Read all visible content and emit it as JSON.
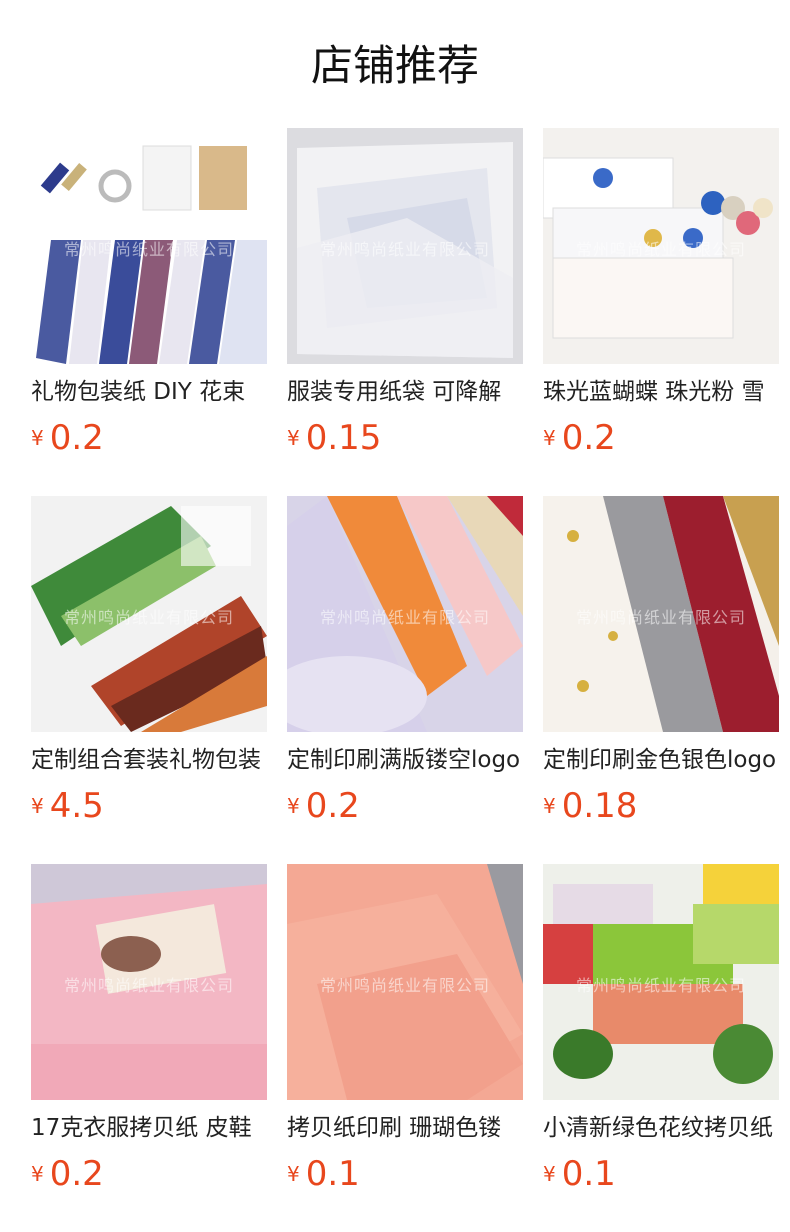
{
  "section_title": "店铺推荐",
  "watermark": "常州鸣尚纸业有限公司",
  "currency": "¥",
  "products": [
    {
      "name": "礼物包装纸 DIY 花束",
      "price": "0.2"
    },
    {
      "name": "服装专用纸袋 可降解",
      "price": "0.15"
    },
    {
      "name": "珠光蓝蝴蝶 珠光粉 雪",
      "price": "0.2"
    },
    {
      "name": "定制组合套装礼物包装",
      "price": "4.5"
    },
    {
      "name": "定制印刷满版镂空logo",
      "price": "0.2"
    },
    {
      "name": "定制印刷金色银色logo",
      "price": "0.18"
    },
    {
      "name": "17克衣服拷贝纸 皮鞋",
      "price": "0.2"
    },
    {
      "name": "拷贝纸印刷 珊瑚色镂",
      "price": "0.1"
    },
    {
      "name": "小清新绿色花纹拷贝纸",
      "price": "0.1"
    }
  ]
}
